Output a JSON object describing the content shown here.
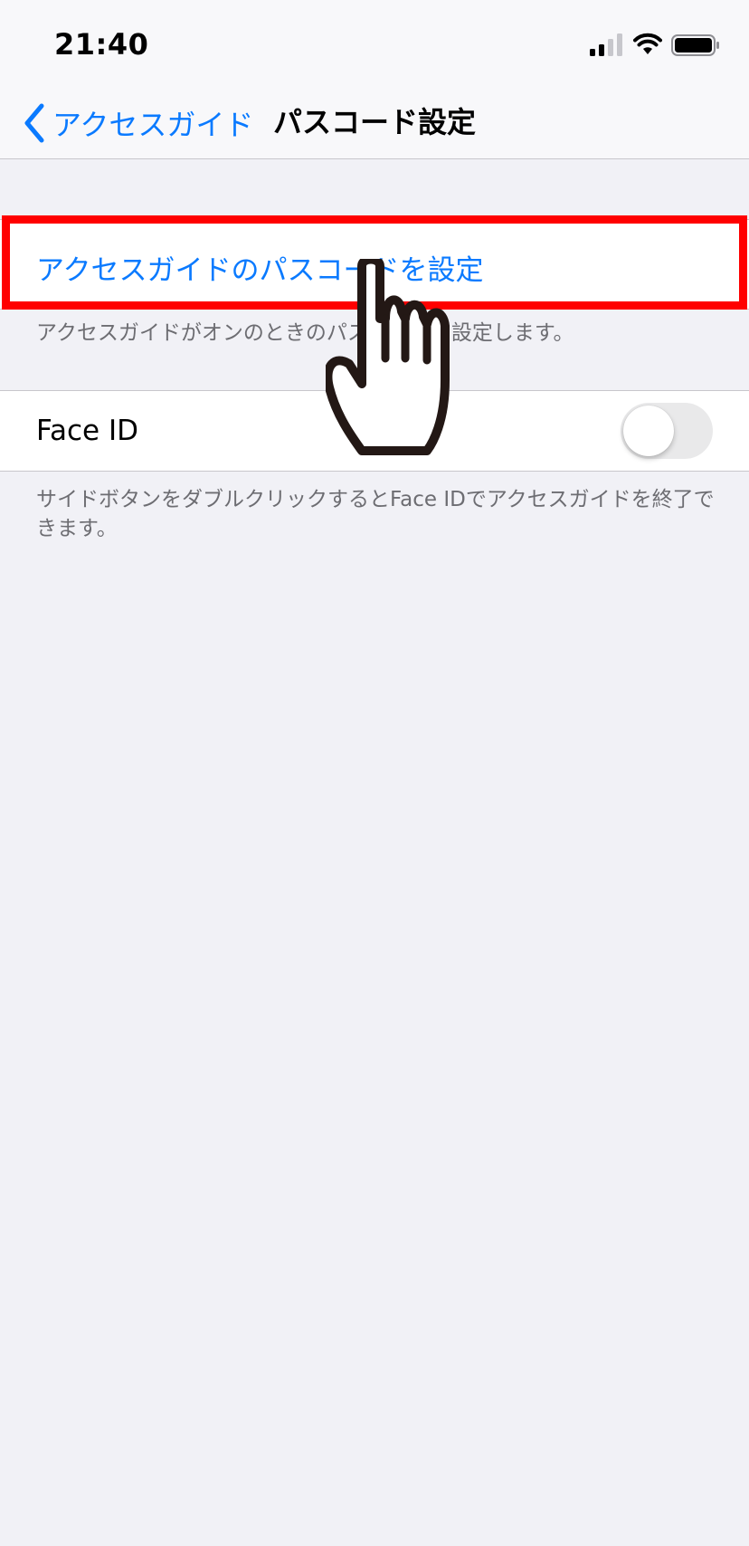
{
  "status_bar": {
    "time": "21:40",
    "signal_icon": "cellular-signal-icon",
    "wifi_icon": "wifi-icon",
    "battery_icon": "battery-icon"
  },
  "nav": {
    "back_label": "アクセスガイド",
    "back_icon": "chevron-left-icon",
    "title": "パスコード設定"
  },
  "section_passcode": {
    "cell_label": "アクセスガイドのパスコードを設定",
    "footer": "アクセスガイドがオンのときのパスコードを設定します。"
  },
  "section_faceid": {
    "label": "Face ID",
    "toggle_on": false,
    "footer": "サイドボタンをダブルクリックするとFace IDでアクセスガイドを終了できます。"
  },
  "colors": {
    "accent": "#0a7aff",
    "highlight": "#ff0000",
    "background": "#f1f1f6"
  }
}
